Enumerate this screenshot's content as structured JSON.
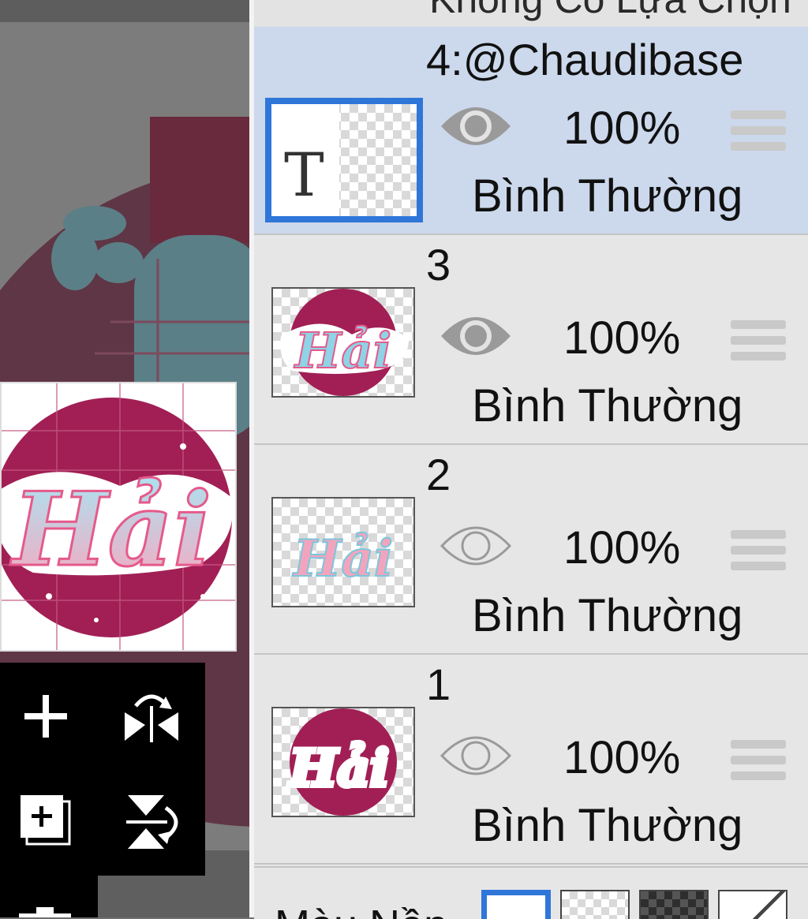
{
  "panel": {
    "header_label": "Không Có Lựa Chọn",
    "layers": [
      {
        "name": "4:@Chaudibase",
        "opacity": "100%",
        "blend_mode": "Bình Thường",
        "visible": true,
        "selected": true,
        "thumbnail": "text-layer",
        "thumb_glyph": "T"
      },
      {
        "name": "3",
        "opacity": "100%",
        "blend_mode": "Bình Thường",
        "visible": true,
        "selected": false,
        "thumbnail": "artwork"
      },
      {
        "name": "2",
        "opacity": "100%",
        "blend_mode": "Bình Thường",
        "visible": false,
        "selected": false,
        "thumbnail": "lettering"
      },
      {
        "name": "1",
        "opacity": "100%",
        "blend_mode": "Bình Thường",
        "visible": false,
        "selected": false,
        "thumbnail": "circle-silhouette"
      }
    ],
    "footer": {
      "label": "Màu Nền",
      "swatches": [
        "white",
        "transparent",
        "dark-checker",
        "custom-diagonal"
      ]
    }
  },
  "toolbar": {
    "buttons": [
      "add-layer-icon",
      "flip-horizontal-icon",
      "duplicate-layer-icon",
      "flip-vertical-icon",
      "delete-layer-icon"
    ]
  },
  "preview": {
    "artwork_text": "Hải"
  },
  "colors": {
    "selected_layer_bg": "#ccd8ec",
    "selection_border": "#2f76d9",
    "panel_bg": "#e6e6e6",
    "art_magenta": "#a11f55"
  }
}
